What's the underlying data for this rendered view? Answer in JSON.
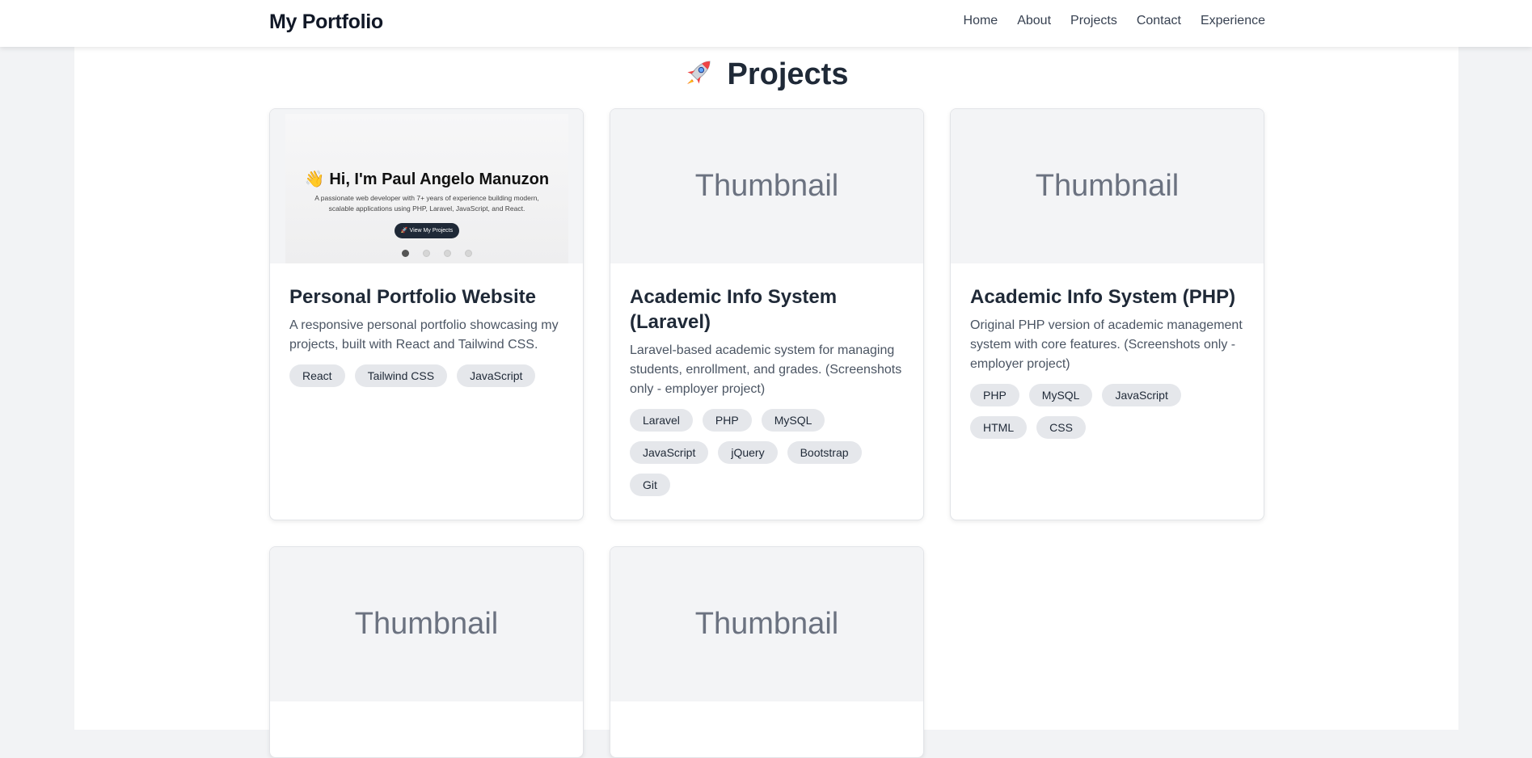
{
  "nav": {
    "brand": "My Portfolio",
    "links": [
      "Home",
      "About",
      "Projects",
      "Contact",
      "Experience"
    ]
  },
  "section": {
    "icon": "rocket-icon",
    "title": "Projects"
  },
  "projects": [
    {
      "thumbnail": "",
      "preview": {
        "heading": "👋 Hi, I'm Paul Angelo Manuzon",
        "subtitle": "A passionate web developer with 7+ years of experience building modern, scalable applications using PHP, Laravel, JavaScript, and React.",
        "button": "🚀 View My Projects"
      },
      "title": "Personal Portfolio Website",
      "description": "A responsive personal portfolio showcasing my projects, built with React and Tailwind CSS.",
      "tags": [
        "React",
        "Tailwind CSS",
        "JavaScript"
      ]
    },
    {
      "thumbnail": "Thumbnail",
      "title": "Academic Info System (Laravel)",
      "description": "Laravel-based academic system for managing students, enrollment, and grades. (Screenshots only - employer project)",
      "tags": [
        "Laravel",
        "PHP",
        "MySQL",
        "JavaScript",
        "jQuery",
        "Bootstrap",
        "Git"
      ]
    },
    {
      "thumbnail": "Thumbnail",
      "title": "Academic Info System (PHP)",
      "description": "Original PHP version of academic management system with core features. (Screenshots only - employer project)",
      "tags": [
        "PHP",
        "MySQL",
        "JavaScript",
        "HTML",
        "CSS"
      ]
    },
    {
      "thumbnail": "Thumbnail",
      "title": "",
      "description": "",
      "tags": []
    },
    {
      "thumbnail": "Thumbnail",
      "title": "",
      "description": "",
      "tags": []
    }
  ]
}
